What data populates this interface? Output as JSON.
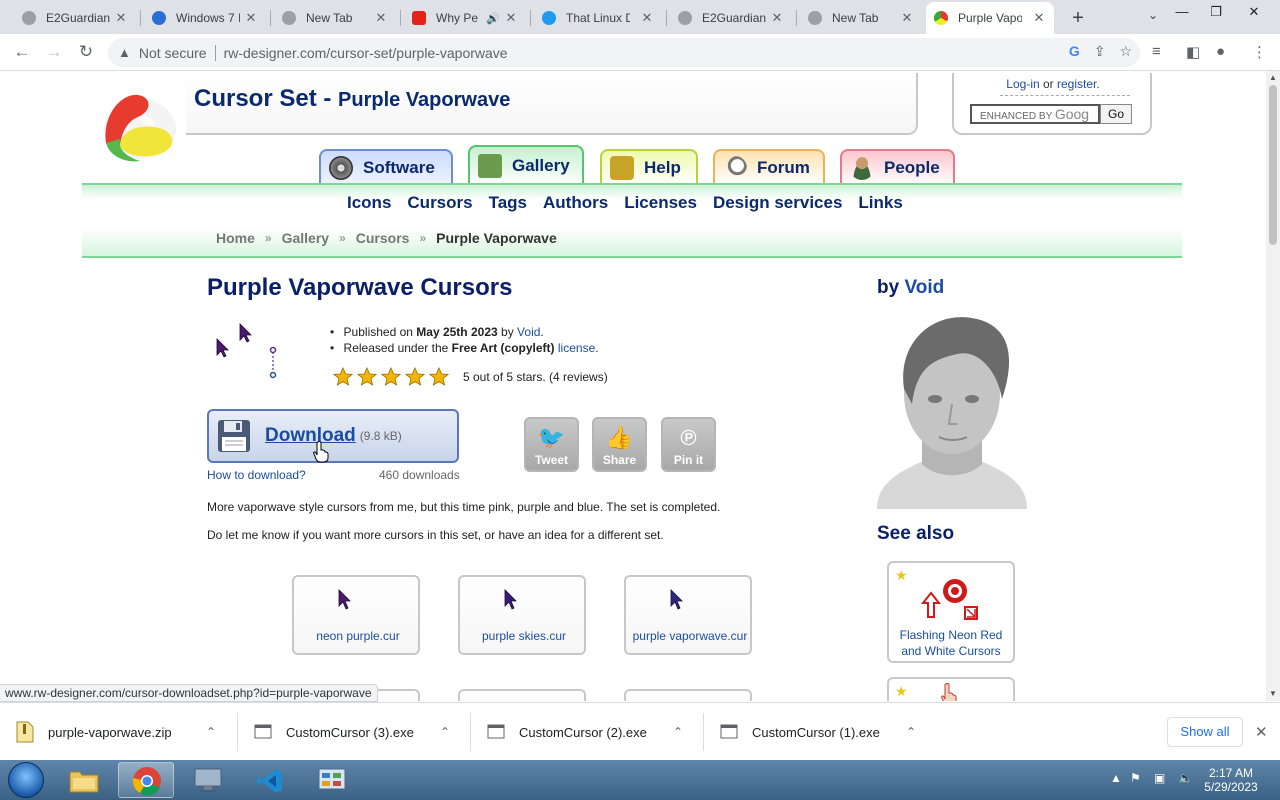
{
  "browser": {
    "tabs": [
      {
        "label": "E2Guardian"
      },
      {
        "label": "Windows 7 I"
      },
      {
        "label": "New Tab"
      },
      {
        "label": "Why Pe"
      },
      {
        "label": "That Linux D"
      },
      {
        "label": "E2Guardian"
      },
      {
        "label": "New Tab"
      },
      {
        "label": "Purple Vapo"
      }
    ],
    "security_label": "Not secure",
    "url": "rw-designer.com/cursor-set/purple-vaporwave"
  },
  "site": {
    "title": "Cursor Set - ",
    "title_sub": "Purple Vaporwave",
    "login": "Log-in",
    "or": "or",
    "register": "register.",
    "search_placeholder": "ENHANCED BY",
    "search_brand": "Goog",
    "go_label": "Go",
    "main_tabs": [
      {
        "label": "Software"
      },
      {
        "label": "Gallery"
      },
      {
        "label": "Help"
      },
      {
        "label": "Forum"
      },
      {
        "label": "People"
      }
    ],
    "sub_nav": [
      "Icons",
      "Cursors",
      "Tags",
      "Authors",
      "Licenses",
      "Design services",
      "Links"
    ],
    "breadcrumb": [
      "Home",
      "Gallery",
      "Cursors"
    ],
    "breadcrumb_current": "Purple Vaporwave"
  },
  "content": {
    "heading": "Purple Vaporwave Cursors",
    "published_prefix": "Published on",
    "published_date": "May 25th 2023",
    "published_by": "by",
    "author": "Void",
    "license_prefix": "Released under the",
    "license_name": "Free Art (copyleft)",
    "license_link": "license",
    "rating_text": "5 out of 5 stars. (4 reviews)",
    "rating_value": 5,
    "download_label": "Download",
    "download_size": "(9.8 kB)",
    "how_to": "How to download?",
    "download_count": "460 downloads",
    "share": [
      {
        "label": "Tweet"
      },
      {
        "label": "Share"
      },
      {
        "label": "Pin it"
      }
    ],
    "description_1": "More vaporwave style cursors from me, but this time pink, purple and blue. The set is completed.",
    "description_2": "Do let me know if you want more cursors in this set, or have an idea for a different set.",
    "cursors": [
      {
        "file": "neon purple.cur"
      },
      {
        "file": "purple skies.cur"
      },
      {
        "file": "purple vaporwave.cur"
      }
    ]
  },
  "sidebar": {
    "by_prefix": "by",
    "author": "Void",
    "see_also": "See also",
    "related": [
      {
        "title": "Flashing Neon Red and White Cursors"
      }
    ]
  },
  "status_link": "www.rw-designer.com/cursor-downloadset.php?id=purple-vaporwave",
  "downloads": {
    "items": [
      {
        "name": "purple-vaporwave.zip"
      },
      {
        "name": "CustomCursor (3).exe"
      },
      {
        "name": "CustomCursor (2).exe"
      },
      {
        "name": "CustomCursor (1).exe"
      }
    ],
    "show_all": "Show all"
  },
  "taskbar": {
    "time": "2:17 AM",
    "date": "5/29/2023"
  },
  "colors": {
    "accent_link": "#1a4d9e",
    "heading": "#0a1f66",
    "navbar_green": "#7fd593"
  }
}
